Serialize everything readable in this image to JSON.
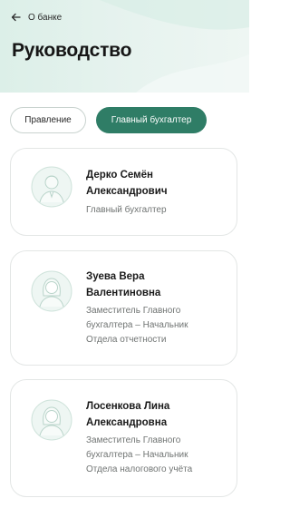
{
  "header": {
    "back_label": "О банке",
    "title": "Руководство"
  },
  "tabs": [
    {
      "label": "Правление",
      "active": false
    },
    {
      "label": "Главный бухгалтер",
      "active": true
    }
  ],
  "people": [
    {
      "name_line1": "Дерко Семён",
      "name_line2": "Александрович",
      "role_lines": [
        "Главный бухгалтер"
      ],
      "avatar": "male-avatar-icon"
    },
    {
      "name_line1": "Зуева Вера",
      "name_line2": "Валентиновна",
      "role_lines": [
        "Заместитель Главного",
        "бухгалтера – Начальник",
        "Отдела отчетности"
      ],
      "avatar": "female-avatar-icon"
    },
    {
      "name_line1": "Лосенкова Лина",
      "name_line2": "Александровна",
      "role_lines": [
        "Заместитель Главного",
        "бухгалтера – Начальник",
        "Отдела налогового учёта"
      ],
      "avatar": "female-avatar-icon"
    }
  ],
  "colors": {
    "accent": "#2f7d66",
    "header_bg": "#e2f1eb"
  }
}
